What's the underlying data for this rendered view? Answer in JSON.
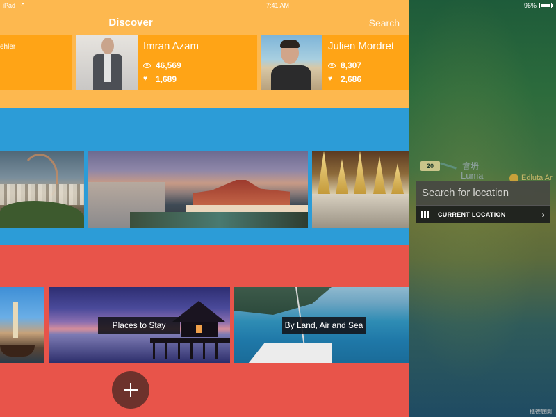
{
  "status_bar": {
    "carrier": "iPad",
    "wifi_icon": "wifi-icon",
    "time": "7:41 AM",
    "battery": "96%"
  },
  "nav": {
    "title": "Discover",
    "search_label": "Search"
  },
  "people": [
    {
      "name": "ehler",
      "views": "",
      "likes": ""
    },
    {
      "name": "Imran Azam",
      "views": "46,569",
      "likes": "1,689"
    },
    {
      "name": "Julien Mordret",
      "views": "8,307",
      "likes": "2,686"
    }
  ],
  "categories": [
    {
      "label": ""
    },
    {
      "label": "Places to Stay"
    },
    {
      "label": "By Land, Air and Sea"
    }
  ],
  "add_icon": "plus-icon",
  "map": {
    "road_number": "20",
    "label_cjk": "會坍",
    "label_luma": "Luma",
    "label_place": "Edluta Ar",
    "watermark": "攜德庭園",
    "location_placeholder": "Search for location",
    "current_location_label": "CURRENT LOCATION",
    "map_icon": "map-icon",
    "chevron_icon": "chevron-right-icon"
  },
  "colors": {
    "people_section": "#fdb84f",
    "person_card": "#ffa416",
    "places_section": "#2c9cd7",
    "categories_section": "#e8544a",
    "add_button": "#6d322c"
  }
}
